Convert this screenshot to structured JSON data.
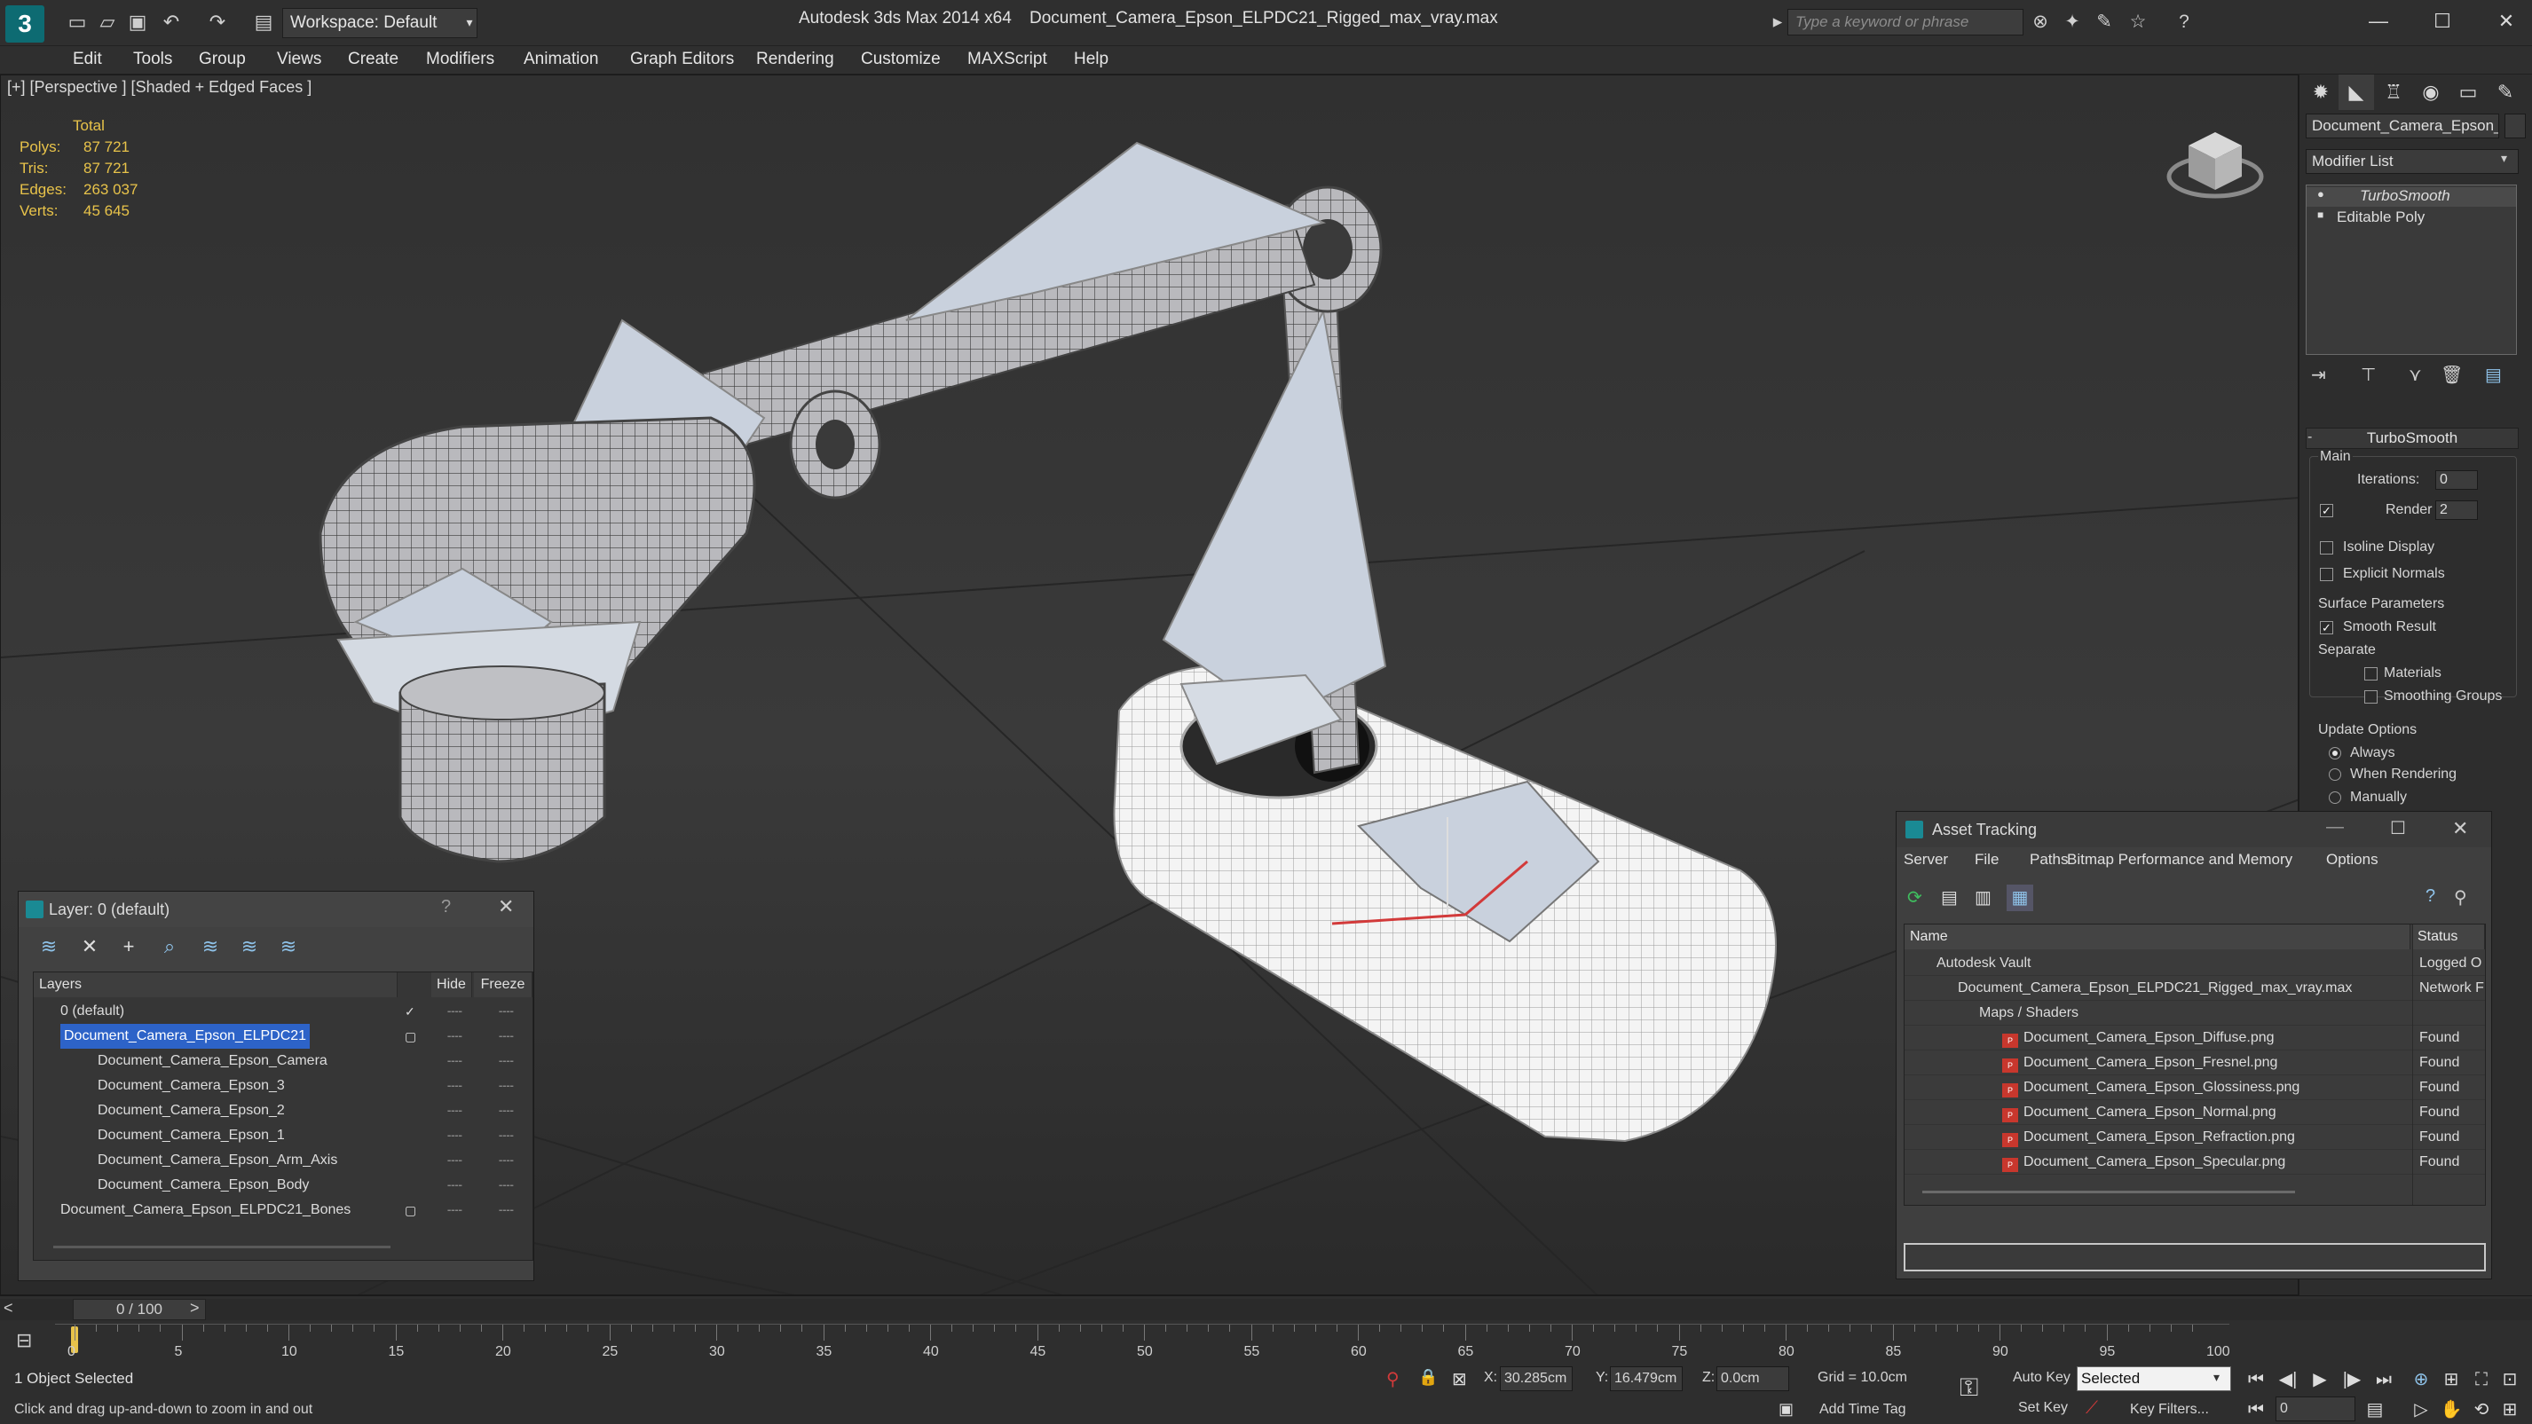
{
  "titlebar": {
    "workspace": "Workspace: Default",
    "app_title": "Autodesk 3ds Max  2014 x64",
    "file_title": "Document_Camera_Epson_ELPDC21_Rigged_max_vray.max",
    "search_placeholder": "Type a keyword or phrase"
  },
  "menu": [
    "Edit",
    "Tools",
    "Group",
    "Views",
    "Create",
    "Modifiers",
    "Animation",
    "Graph Editors",
    "Rendering",
    "Customize",
    "MAXScript",
    "Help"
  ],
  "viewport": {
    "label": "[+] [Perspective ] [Shaded + Edged Faces ]",
    "stats_header": "Total",
    "stats": [
      {
        "k": "Polys:",
        "v": "87 721"
      },
      {
        "k": "Tris:",
        "v": "87 721"
      },
      {
        "k": "Edges:",
        "v": "263 037"
      },
      {
        "k": "Verts:",
        "v": "45 645"
      }
    ]
  },
  "command_panel": {
    "object_name": "Document_Camera_Epson_El",
    "modifier_list": "Modifier List",
    "stack": [
      "TurboSmooth",
      "Editable Poly"
    ],
    "rollout": "TurboSmooth",
    "main_label": "Main",
    "iterations_label": "Iterations:",
    "iterations": "0",
    "render_iters_label": "Render Iters:",
    "render_iters": "2",
    "isoline": "Isoline Display",
    "explicit_normals": "Explicit Normals",
    "surface_params": "Surface Parameters",
    "smooth_result": "Smooth Result",
    "separate": "Separate",
    "materials": "Materials",
    "smoothing_groups": "Smoothing Groups",
    "update_options": "Update Options",
    "always": "Always",
    "when_rendering": "When Rendering",
    "manually": "Manually"
  },
  "layer_dialog": {
    "title": "Layer: 0 (default)",
    "help": "?",
    "col_layers": "Layers",
    "col_hide": "Hide",
    "col_freeze": "Freeze",
    "rows": [
      {
        "name": "0 (default)",
        "indent": 0
      },
      {
        "name": "Document_Camera_Epson_ELPDC21",
        "indent": 0
      },
      {
        "name": "Document_Camera_Epson_Camera",
        "indent": 1
      },
      {
        "name": "Document_Camera_Epson_3",
        "indent": 1
      },
      {
        "name": "Document_Camera_Epson_2",
        "indent": 1
      },
      {
        "name": "Document_Camera_Epson_1",
        "indent": 1
      },
      {
        "name": "Document_Camera_Epson_Arm_Axis",
        "indent": 1
      },
      {
        "name": "Document_Camera_Epson_Body",
        "indent": 1
      },
      {
        "name": "Document_Camera_Epson_ELPDC21_Bones",
        "indent": 0
      }
    ]
  },
  "asset_dialog": {
    "title": "Asset Tracking",
    "menu": [
      "Server",
      "File",
      "Paths",
      "Bitmap Performance and Memory",
      "Options"
    ],
    "col_name": "Name",
    "col_status": "Status",
    "rows": [
      {
        "name": "Autodesk Vault",
        "status": "Logged O"
      },
      {
        "name": "Document_Camera_Epson_ELPDC21_Rigged_max_vray.max",
        "status": "Network F"
      },
      {
        "name": "Maps / Shaders",
        "status": ""
      },
      {
        "name": "Document_Camera_Epson_Diffuse.png",
        "status": "Found"
      },
      {
        "name": "Document_Camera_Epson_Fresnel.png",
        "status": "Found"
      },
      {
        "name": "Document_Camera_Epson_Glossiness.png",
        "status": "Found"
      },
      {
        "name": "Document_Camera_Epson_Normal.png",
        "status": "Found"
      },
      {
        "name": "Document_Camera_Epson_Refraction.png",
        "status": "Found"
      },
      {
        "name": "Document_Camera_Epson_Specular.png",
        "status": "Found"
      }
    ]
  },
  "timeline": {
    "frame": "0 / 100",
    "ticks": [
      "0",
      "5",
      "10",
      "15",
      "20",
      "25",
      "30",
      "35",
      "40",
      "45",
      "50",
      "55",
      "60",
      "65",
      "70",
      "75",
      "80",
      "85",
      "90",
      "95",
      "100"
    ]
  },
  "status": {
    "selected": "1 Object Selected",
    "hint": "Click and drag up-and-down to zoom in and out",
    "x_label": "X:",
    "x": "30.285cm",
    "y_label": "Y:",
    "y": "16.479cm",
    "z_label": "Z:",
    "z": "0.0cm",
    "grid": "Grid = 10.0cm",
    "auto_key": "Auto Key",
    "key_mode": "Selected",
    "set_key": "Set Key",
    "key_filters": "Key Filters...",
    "add_time_tag": "Add Time Tag",
    "frame_field": "0"
  }
}
